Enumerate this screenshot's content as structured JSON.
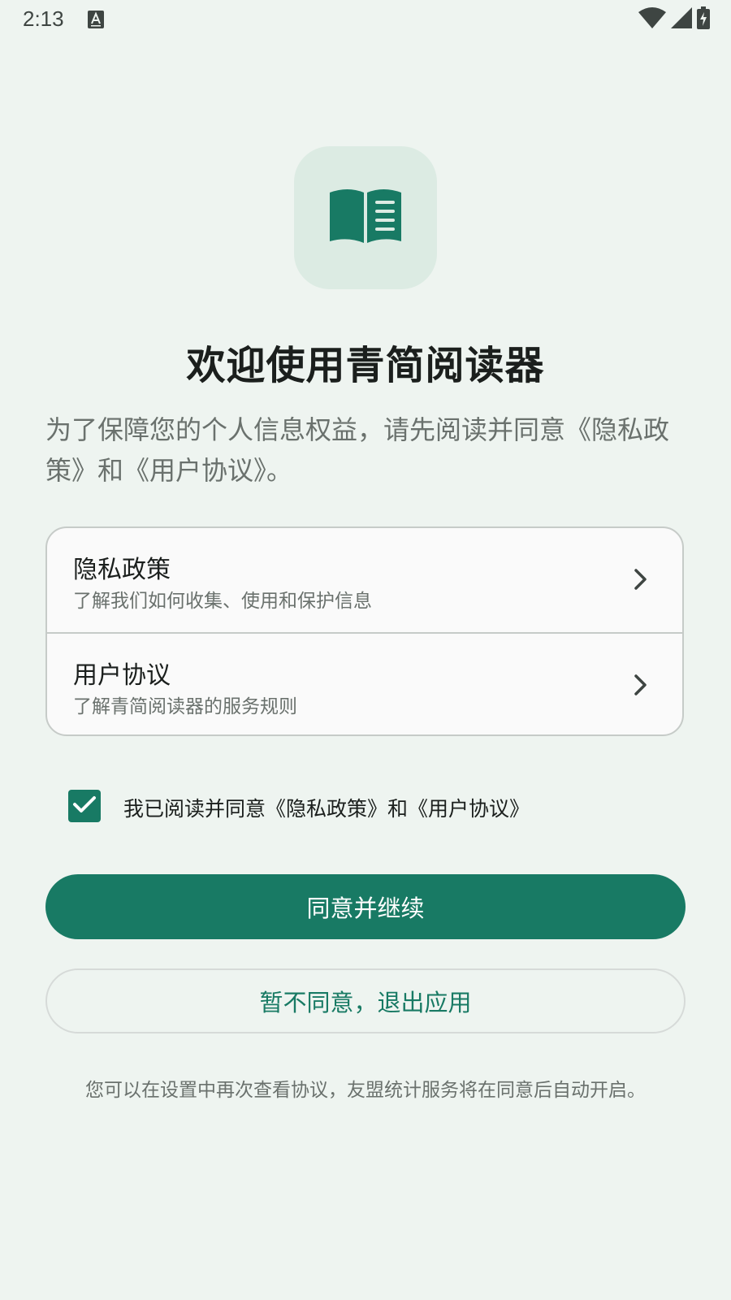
{
  "status_bar": {
    "time": "2:13",
    "icons": [
      "text-input-icon",
      "wifi-icon",
      "signal-icon",
      "battery-charging-icon"
    ]
  },
  "logo": {
    "icon": "open-book-icon"
  },
  "welcome": {
    "title": "欢迎使用青简阅读器",
    "intro": "为了保障您的个人信息权益，请先阅读并同意《隐私政策》和《用户协议》。"
  },
  "documents": [
    {
      "title": "隐私政策",
      "subtitle": "了解我们如何收集、使用和保护信息",
      "icon": "chevron-right-icon"
    },
    {
      "title": "用户协议",
      "subtitle": "了解青简阅读器的服务规则",
      "icon": "chevron-right-icon"
    }
  ],
  "consent": {
    "checked": true,
    "label": "我已阅读并同意《隐私政策》和《用户协议》"
  },
  "actions": {
    "agree_label": "同意并继续",
    "decline_label": "暂不同意，退出应用"
  },
  "footer": {
    "note": "您可以在设置中再次查看协议，友盟统计服务将在同意后自动开启。"
  },
  "colors": {
    "background": "#EEF4F0",
    "accent": "#187A64",
    "logo_tile": "#DCEBE3",
    "card": "#FAFAFA",
    "text_primary": "#1B1F1D",
    "text_secondary": "#6A716D"
  }
}
